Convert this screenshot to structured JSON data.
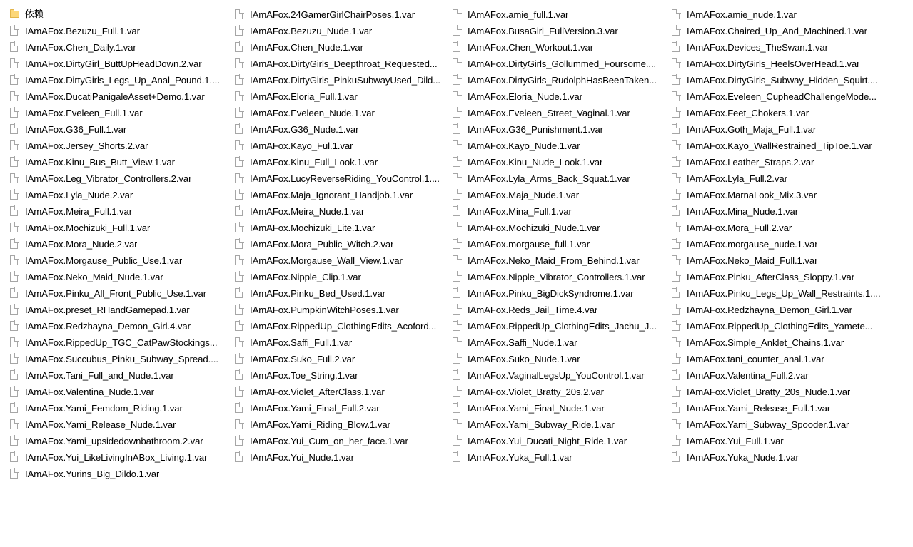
{
  "view": {
    "type": "file-explorer-list",
    "icon_names": {
      "folder": "folder-icon",
      "file": "file-icon"
    },
    "colors": {
      "background": "#ffffff",
      "text": "#000000",
      "folder": "#fcd779",
      "file_outline": "#a6a6a6"
    }
  },
  "columns": [
    {
      "items": [
        {
          "name": "依赖",
          "kind": "folder"
        },
        {
          "name": "IAmAFox.Bezuzu_Full.1.var",
          "kind": "file"
        },
        {
          "name": "IAmAFox.Chen_Daily.1.var",
          "kind": "file"
        },
        {
          "name": "IAmAFox.DirtyGirl_ButtUpHeadDown.2.var",
          "kind": "file"
        },
        {
          "name": "IAmAFox.DirtyGirls_Legs_Up_Anal_Pound.1....",
          "kind": "file"
        },
        {
          "name": "IAmAFox.DucatiPanigaleAsset+Demo.1.var",
          "kind": "file"
        },
        {
          "name": "IAmAFox.Eveleen_Full.1.var",
          "kind": "file"
        },
        {
          "name": "IAmAFox.G36_Full.1.var",
          "kind": "file"
        },
        {
          "name": "IAmAFox.Jersey_Shorts.2.var",
          "kind": "file"
        },
        {
          "name": "IAmAFox.Kinu_Bus_Butt_View.1.var",
          "kind": "file"
        },
        {
          "name": "IAmAFox.Leg_Vibrator_Controllers.2.var",
          "kind": "file"
        },
        {
          "name": "IAmAFox.Lyla_Nude.2.var",
          "kind": "file"
        },
        {
          "name": "IAmAFox.Meira_Full.1.var",
          "kind": "file"
        },
        {
          "name": "IAmAFox.Mochizuki_Full.1.var",
          "kind": "file"
        },
        {
          "name": "IAmAFox.Mora_Nude.2.var",
          "kind": "file"
        },
        {
          "name": "IAmAFox.Morgause_Public_Use.1.var",
          "kind": "file"
        },
        {
          "name": "IAmAFox.Neko_Maid_Nude.1.var",
          "kind": "file"
        },
        {
          "name": "IAmAFox.Pinku_All_Front_Public_Use.1.var",
          "kind": "file"
        },
        {
          "name": "IAmAFox.preset_RHandGamepad.1.var",
          "kind": "file"
        },
        {
          "name": "IAmAFox.Redzhayna_Demon_Girl.4.var",
          "kind": "file"
        },
        {
          "name": "IAmAFox.RippedUp_TGC_CatPawStockings...",
          "kind": "file"
        },
        {
          "name": "IAmAFox.Succubus_Pinku_Subway_Spread....",
          "kind": "file"
        },
        {
          "name": "IAmAFox.Tani_Full_and_Nude.1.var",
          "kind": "file"
        },
        {
          "name": "IAmAFox.Valentina_Nude.1.var",
          "kind": "file"
        },
        {
          "name": "IAmAFox.Yami_Femdom_Riding.1.var",
          "kind": "file"
        },
        {
          "name": "IAmAFox.Yami_Release_Nude.1.var",
          "kind": "file"
        },
        {
          "name": "IAmAFox.Yami_upsidedownbathroom.2.var",
          "kind": "file"
        },
        {
          "name": "IAmAFox.Yui_LikeLivingInABox_Living.1.var",
          "kind": "file"
        },
        {
          "name": "IAmAFox.Yurins_Big_Dildo.1.var",
          "kind": "file"
        }
      ]
    },
    {
      "items": [
        {
          "name": "IAmAFox.24GamerGirlChairPoses.1.var",
          "kind": "file"
        },
        {
          "name": "IAmAFox.Bezuzu_Nude.1.var",
          "kind": "file"
        },
        {
          "name": "IAmAFox.Chen_Nude.1.var",
          "kind": "file"
        },
        {
          "name": "IAmAFox.DirtyGirls_Deepthroat_Requested...",
          "kind": "file"
        },
        {
          "name": "IAmAFox.DirtyGirls_PinkuSubwayUsed_Dild...",
          "kind": "file"
        },
        {
          "name": "IAmAFox.Eloria_Full.1.var",
          "kind": "file"
        },
        {
          "name": "IAmAFox.Eveleen_Nude.1.var",
          "kind": "file"
        },
        {
          "name": "IAmAFox.G36_Nude.1.var",
          "kind": "file"
        },
        {
          "name": "IAmAFox.Kayo_Ful.1.var",
          "kind": "file"
        },
        {
          "name": "IAmAFox.Kinu_Full_Look.1.var",
          "kind": "file"
        },
        {
          "name": "IAmAFox.LucyReverseRiding_YouControl.1....",
          "kind": "file"
        },
        {
          "name": "IAmAFox.Maja_Ignorant_Handjob.1.var",
          "kind": "file"
        },
        {
          "name": "IAmAFox.Meira_Nude.1.var",
          "kind": "file"
        },
        {
          "name": "IAmAFox.Mochizuki_Lite.1.var",
          "kind": "file"
        },
        {
          "name": "IAmAFox.Mora_Public_Witch.2.var",
          "kind": "file"
        },
        {
          "name": "IAmAFox.Morgause_Wall_View.1.var",
          "kind": "file"
        },
        {
          "name": "IAmAFox.Nipple_Clip.1.var",
          "kind": "file"
        },
        {
          "name": "IAmAFox.Pinku_Bed_Used.1.var",
          "kind": "file"
        },
        {
          "name": "IAmAFox.PumpkinWitchPoses.1.var",
          "kind": "file"
        },
        {
          "name": "IAmAFox.RippedUp_ClothingEdits_Acoford...",
          "kind": "file"
        },
        {
          "name": "IAmAFox.Saffi_Full.1.var",
          "kind": "file"
        },
        {
          "name": "IAmAFox.Suko_Full.2.var",
          "kind": "file"
        },
        {
          "name": "IAmAFox.Toe_String.1.var",
          "kind": "file"
        },
        {
          "name": "IAmAFox.Violet_AfterClass.1.var",
          "kind": "file"
        },
        {
          "name": "IAmAFox.Yami_Final_Full.2.var",
          "kind": "file"
        },
        {
          "name": "IAmAFox.Yami_Riding_Blow.1.var",
          "kind": "file"
        },
        {
          "name": "IAmAFox.Yui_Cum_on_her_face.1.var",
          "kind": "file"
        },
        {
          "name": "IAmAFox.Yui_Nude.1.var",
          "kind": "file"
        }
      ]
    },
    {
      "items": [
        {
          "name": "IAmAFox.amie_full.1.var",
          "kind": "file"
        },
        {
          "name": "IAmAFox.BusaGirl_FullVersion.3.var",
          "kind": "file"
        },
        {
          "name": "IAmAFox.Chen_Workout.1.var",
          "kind": "file"
        },
        {
          "name": "IAmAFox.DirtyGirls_Gollummed_Foursome....",
          "kind": "file"
        },
        {
          "name": "IAmAFox.DirtyGirls_RudolphHasBeenTaken...",
          "kind": "file"
        },
        {
          "name": "IAmAFox.Eloria_Nude.1.var",
          "kind": "file"
        },
        {
          "name": "IAmAFox.Eveleen_Street_Vaginal.1.var",
          "kind": "file"
        },
        {
          "name": "IAmAFox.G36_Punishment.1.var",
          "kind": "file"
        },
        {
          "name": "IAmAFox.Kayo_Nude.1.var",
          "kind": "file"
        },
        {
          "name": "IAmAFox.Kinu_Nude_Look.1.var",
          "kind": "file"
        },
        {
          "name": "IAmAFox.Lyla_Arms_Back_Squat.1.var",
          "kind": "file"
        },
        {
          "name": "IAmAFox.Maja_Nude.1.var",
          "kind": "file"
        },
        {
          "name": "IAmAFox.Mina_Full.1.var",
          "kind": "file"
        },
        {
          "name": "IAmAFox.Mochizuki_Nude.1.var",
          "kind": "file"
        },
        {
          "name": "IAmAFox.morgause_full.1.var",
          "kind": "file"
        },
        {
          "name": "IAmAFox.Neko_Maid_From_Behind.1.var",
          "kind": "file"
        },
        {
          "name": "IAmAFox.Nipple_Vibrator_Controllers.1.var",
          "kind": "file"
        },
        {
          "name": "IAmAFox.Pinku_BigDickSyndrome.1.var",
          "kind": "file"
        },
        {
          "name": "IAmAFox.Reds_Jail_Time.4.var",
          "kind": "file"
        },
        {
          "name": "IAmAFox.RippedUp_ClothingEdits_Jachu_J...",
          "kind": "file"
        },
        {
          "name": "IAmAFox.Saffi_Nude.1.var",
          "kind": "file"
        },
        {
          "name": "IAmAFox.Suko_Nude.1.var",
          "kind": "file"
        },
        {
          "name": "IAmAFox.VaginalLegsUp_YouControl.1.var",
          "kind": "file"
        },
        {
          "name": "IAmAFox.Violet_Bratty_20s.2.var",
          "kind": "file"
        },
        {
          "name": "IAmAFox.Yami_Final_Nude.1.var",
          "kind": "file"
        },
        {
          "name": "IAmAFox.Yami_Subway_Ride.1.var",
          "kind": "file"
        },
        {
          "name": "IAmAFox.Yui_Ducati_Night_Ride.1.var",
          "kind": "file"
        },
        {
          "name": "IAmAFox.Yuka_Full.1.var",
          "kind": "file"
        }
      ]
    },
    {
      "items": [
        {
          "name": "IAmAFox.amie_nude.1.var",
          "kind": "file"
        },
        {
          "name": "IAmAFox.Chaired_Up_And_Machined.1.var",
          "kind": "file"
        },
        {
          "name": "IAmAFox.Devices_TheSwan.1.var",
          "kind": "file"
        },
        {
          "name": "IAmAFox.DirtyGirls_HeelsOverHead.1.var",
          "kind": "file"
        },
        {
          "name": "IAmAFox.DirtyGirls_Subway_Hidden_Squirt....",
          "kind": "file"
        },
        {
          "name": "IAmAFox.Eveleen_CupheadChallengeMode...",
          "kind": "file"
        },
        {
          "name": "IAmAFox.Feet_Chokers.1.var",
          "kind": "file"
        },
        {
          "name": "IAmAFox.Goth_Maja_Full.1.var",
          "kind": "file"
        },
        {
          "name": "IAmAFox.Kayo_WallRestrained_TipToe.1.var",
          "kind": "file"
        },
        {
          "name": "IAmAFox.Leather_Straps.2.var",
          "kind": "file"
        },
        {
          "name": "IAmAFox.Lyla_Full.2.var",
          "kind": "file"
        },
        {
          "name": "IAmAFox.MarnaLook_Mix.3.var",
          "kind": "file"
        },
        {
          "name": "IAmAFox.Mina_Nude.1.var",
          "kind": "file"
        },
        {
          "name": "IAmAFox.Mora_Full.2.var",
          "kind": "file"
        },
        {
          "name": "IAmAFox.morgause_nude.1.var",
          "kind": "file"
        },
        {
          "name": "IAmAFox.Neko_Maid_Full.1.var",
          "kind": "file"
        },
        {
          "name": "IAmAFox.Pinku_AfterClass_Sloppy.1.var",
          "kind": "file"
        },
        {
          "name": "IAmAFox.Pinku_Legs_Up_Wall_Restraints.1....",
          "kind": "file"
        },
        {
          "name": "IAmAFox.Redzhayna_Demon_Girl.1.var",
          "kind": "file"
        },
        {
          "name": "IAmAFox.RippedUp_ClothingEdits_Yamete...",
          "kind": "file"
        },
        {
          "name": "IAmAFox.Simple_Anklet_Chains.1.var",
          "kind": "file"
        },
        {
          "name": "IAmAFox.tani_counter_anal.1.var",
          "kind": "file"
        },
        {
          "name": "IAmAFox.Valentina_Full.2.var",
          "kind": "file"
        },
        {
          "name": "IAmAFox.Violet_Bratty_20s_Nude.1.var",
          "kind": "file"
        },
        {
          "name": "IAmAFox.Yami_Release_Full.1.var",
          "kind": "file"
        },
        {
          "name": "IAmAFox.Yami_Subway_Spooder.1.var",
          "kind": "file"
        },
        {
          "name": "IAmAFox.Yui_Full.1.var",
          "kind": "file"
        },
        {
          "name": "IAmAFox.Yuka_Nude.1.var",
          "kind": "file"
        }
      ]
    }
  ]
}
